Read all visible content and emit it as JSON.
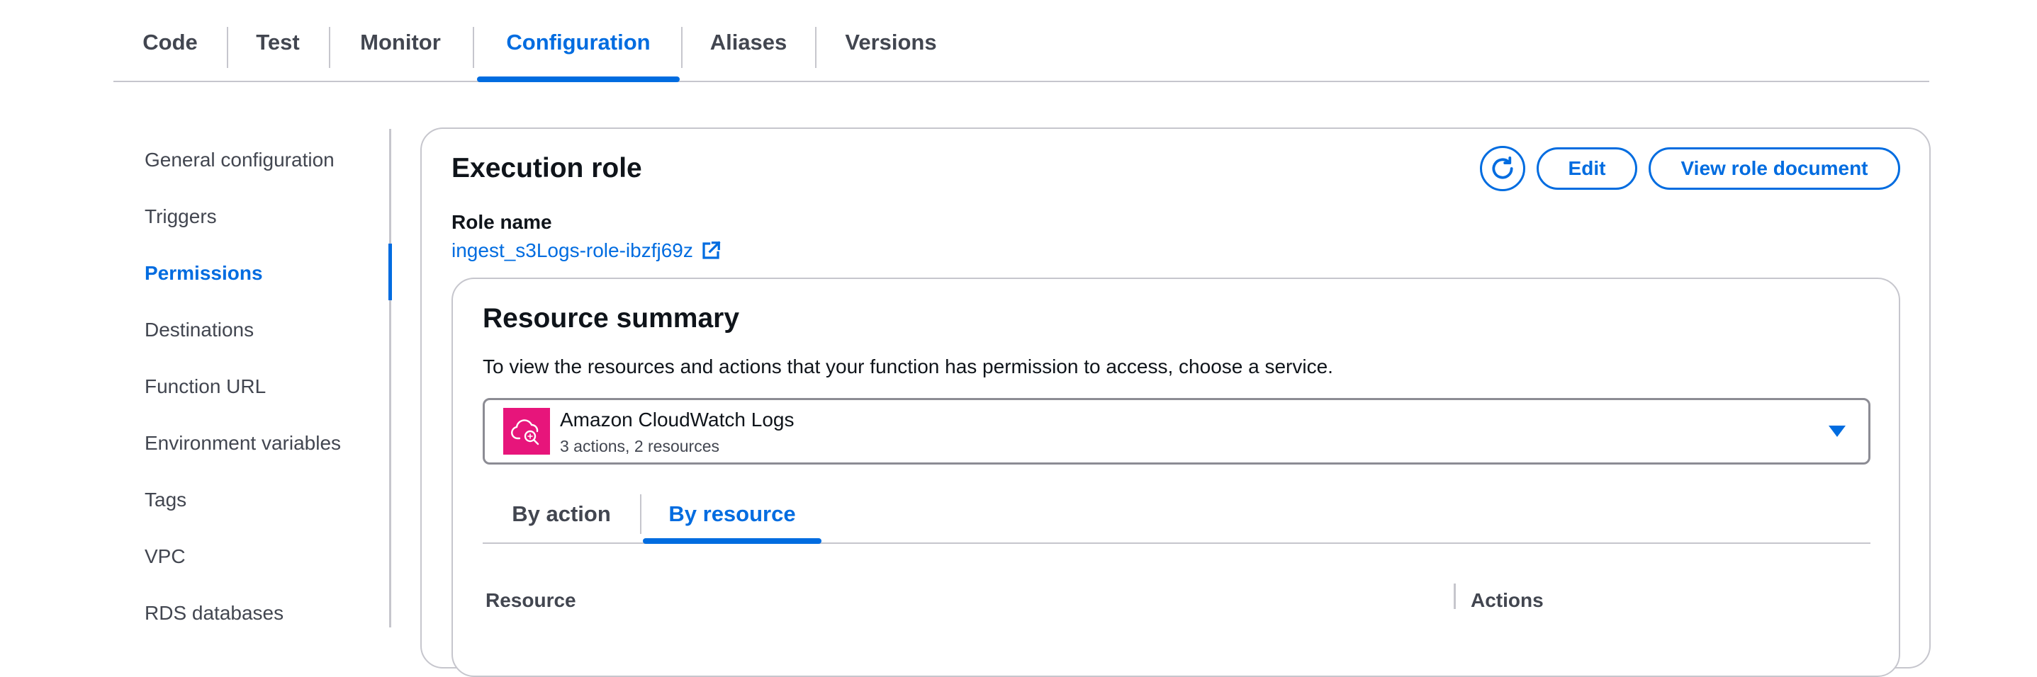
{
  "tabs": [
    "Code",
    "Test",
    "Monitor",
    "Configuration",
    "Aliases",
    "Versions"
  ],
  "active_tab": "Configuration",
  "sidebar": {
    "items": [
      "General configuration",
      "Triggers",
      "Permissions",
      "Destinations",
      "Function URL",
      "Environment variables",
      "Tags",
      "VPC",
      "RDS databases"
    ],
    "active": "Permissions"
  },
  "execution_role": {
    "title": "Execution role",
    "edit_label": "Edit",
    "view_label": "View role document",
    "role_name_label": "Role name",
    "role_name": "ingest_s3Logs-role-ibzfj69z"
  },
  "resource_summary": {
    "title": "Resource summary",
    "description": "To view the resources and actions that your function has permission to access, choose a service.",
    "service": {
      "name": "Amazon CloudWatch Logs",
      "meta": "3 actions, 2 resources",
      "icon_color": "#e7157b"
    },
    "tabs": [
      "By action",
      "By resource"
    ],
    "active_tab": "By resource",
    "columns": [
      "Resource",
      "Actions"
    ]
  },
  "colors": {
    "accent": "#006ce0",
    "text": "#0f141a",
    "muted": "#424650",
    "border": "#c6c6cd"
  },
  "icons": {
    "refresh": "refresh-icon",
    "external_link": "external-link-icon",
    "service": "cloudwatch-logs-icon",
    "dropdown": "caret-down-icon"
  }
}
